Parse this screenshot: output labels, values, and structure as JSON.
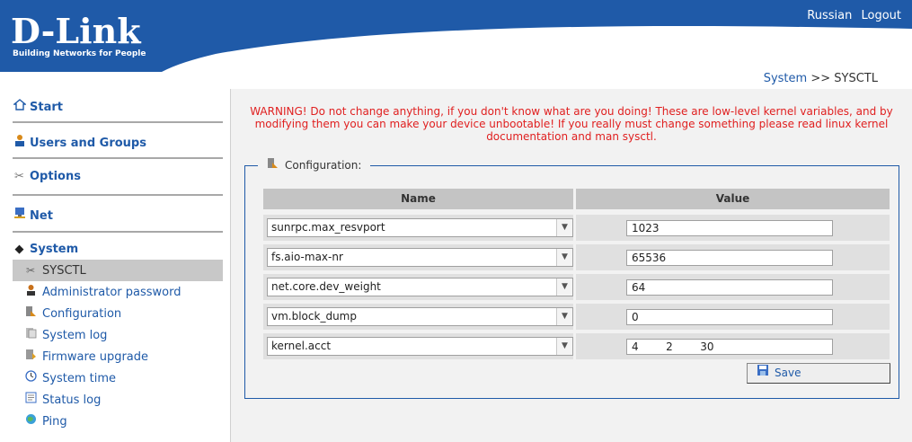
{
  "header": {
    "logo": "D-Link",
    "tagline": "Building Networks for People",
    "links": [
      "Russian",
      "Logout"
    ],
    "colors": {
      "brand": "#1F5AA8",
      "warning": "#E02020"
    }
  },
  "breadcrumb": {
    "section": "System",
    "separator": ">>",
    "page": "SYSCTL"
  },
  "sidebar": {
    "sections": [
      {
        "label": "Start",
        "icon": "home-icon"
      },
      {
        "label": "Users and Groups",
        "icon": "users-icon"
      },
      {
        "label": "Options",
        "icon": "tools-icon"
      },
      {
        "label": "Net",
        "icon": "network-icon"
      },
      {
        "label": "System",
        "icon": "diamond-icon"
      }
    ],
    "items": [
      {
        "label": "SYSCTL",
        "icon": "tools-icon",
        "active": true
      },
      {
        "label": "Administrator password",
        "icon": "admin-icon"
      },
      {
        "label": "Configuration",
        "icon": "config-icon"
      },
      {
        "label": "System log",
        "icon": "log-icon"
      },
      {
        "label": "Firmware upgrade",
        "icon": "firmware-icon"
      },
      {
        "label": "System time",
        "icon": "clock-icon"
      },
      {
        "label": "Status log",
        "icon": "status-log-icon"
      },
      {
        "label": "Ping",
        "icon": "ping-icon"
      }
    ]
  },
  "main": {
    "warning": "WARNING! Do not change anything, if you don't know what are you doing! These are low-level kernel variables, and by modifying them you can make your device unbootable! If you really must change something please read linux kernel documentation and man sysctl.",
    "legend": "Configuration:",
    "columns": {
      "name": "Name",
      "value": "Value"
    },
    "rows": [
      {
        "name": "sunrpc.max_resvport",
        "value": "1023"
      },
      {
        "name": "fs.aio-max-nr",
        "value": "65536"
      },
      {
        "name": "net.core.dev_weight",
        "value": "64"
      },
      {
        "name": "vm.block_dump",
        "value": "0"
      },
      {
        "name": "kernel.acct",
        "value": "4        2        30"
      }
    ],
    "save_label": "Save"
  }
}
